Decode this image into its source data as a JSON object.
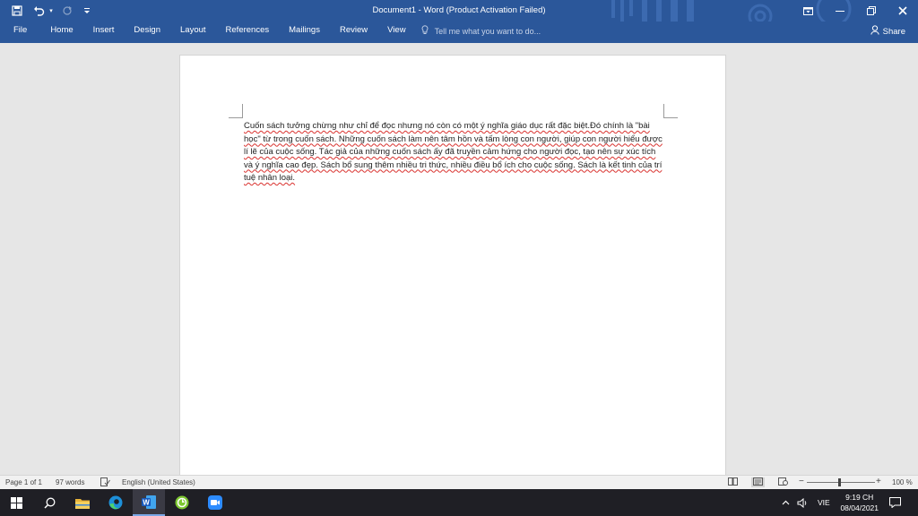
{
  "window": {
    "title": "Document1  -  Word (Product Activation Failed)"
  },
  "ribbon": {
    "tabs": [
      "File",
      "Home",
      "Insert",
      "Design",
      "Layout",
      "References",
      "Mailings",
      "Review",
      "View"
    ],
    "tell_me_placeholder": "Tell me what you want to do...",
    "share_label": "Share"
  },
  "document": {
    "body_text": "Cuốn sách tưởng chừng như chỉ để đọc nhưng nó còn có một ý nghĩa  giáo dục rất đặc biệt.Đó chính là \"bài học\" từ trong cuốn sách. Những cuốn sách làm nên tâm hồn và tấm lòng con người, giúp con người hiểu được lí lẽ của cuộc sống. Tác giả của những cuốn sách ấy đã truyền cảm hứng cho người đọc, tạo nên sự xúc tích và ý nghĩa cao đẹp. Sách bổ sung thêm nhiều tri thức, nhiều điều bổ ích cho cuộc sống. Sách là kết tinh của trí tuệ nhân loại."
  },
  "status_bar": {
    "page": "Page 1 of 1",
    "words": "97 words",
    "language": "English (United States)",
    "zoom": "100 %",
    "zoom_value": 100
  },
  "taskbar": {
    "language": "VIE",
    "time": "9:19 CH",
    "date": "08/04/2021"
  },
  "colors": {
    "word_blue": "#2b579a",
    "spell_red": "#d9312e",
    "taskbar": "#1f1f25"
  },
  "icons": [
    "save-icon",
    "undo-icon",
    "redo-icon",
    "customize-qat-icon",
    "ribbon-display-icon",
    "minimize-icon",
    "restore-icon",
    "close-icon",
    "lightbulb-icon",
    "share-person-icon",
    "proofing-icon",
    "read-mode-icon",
    "print-layout-icon",
    "web-layout-icon",
    "windows-start-icon",
    "search-icon",
    "file-explorer-icon",
    "edge-icon",
    "word-icon",
    "green-app-icon",
    "zoom-app-icon",
    "tray-chevron-icon",
    "speaker-icon",
    "notifications-icon"
  ]
}
